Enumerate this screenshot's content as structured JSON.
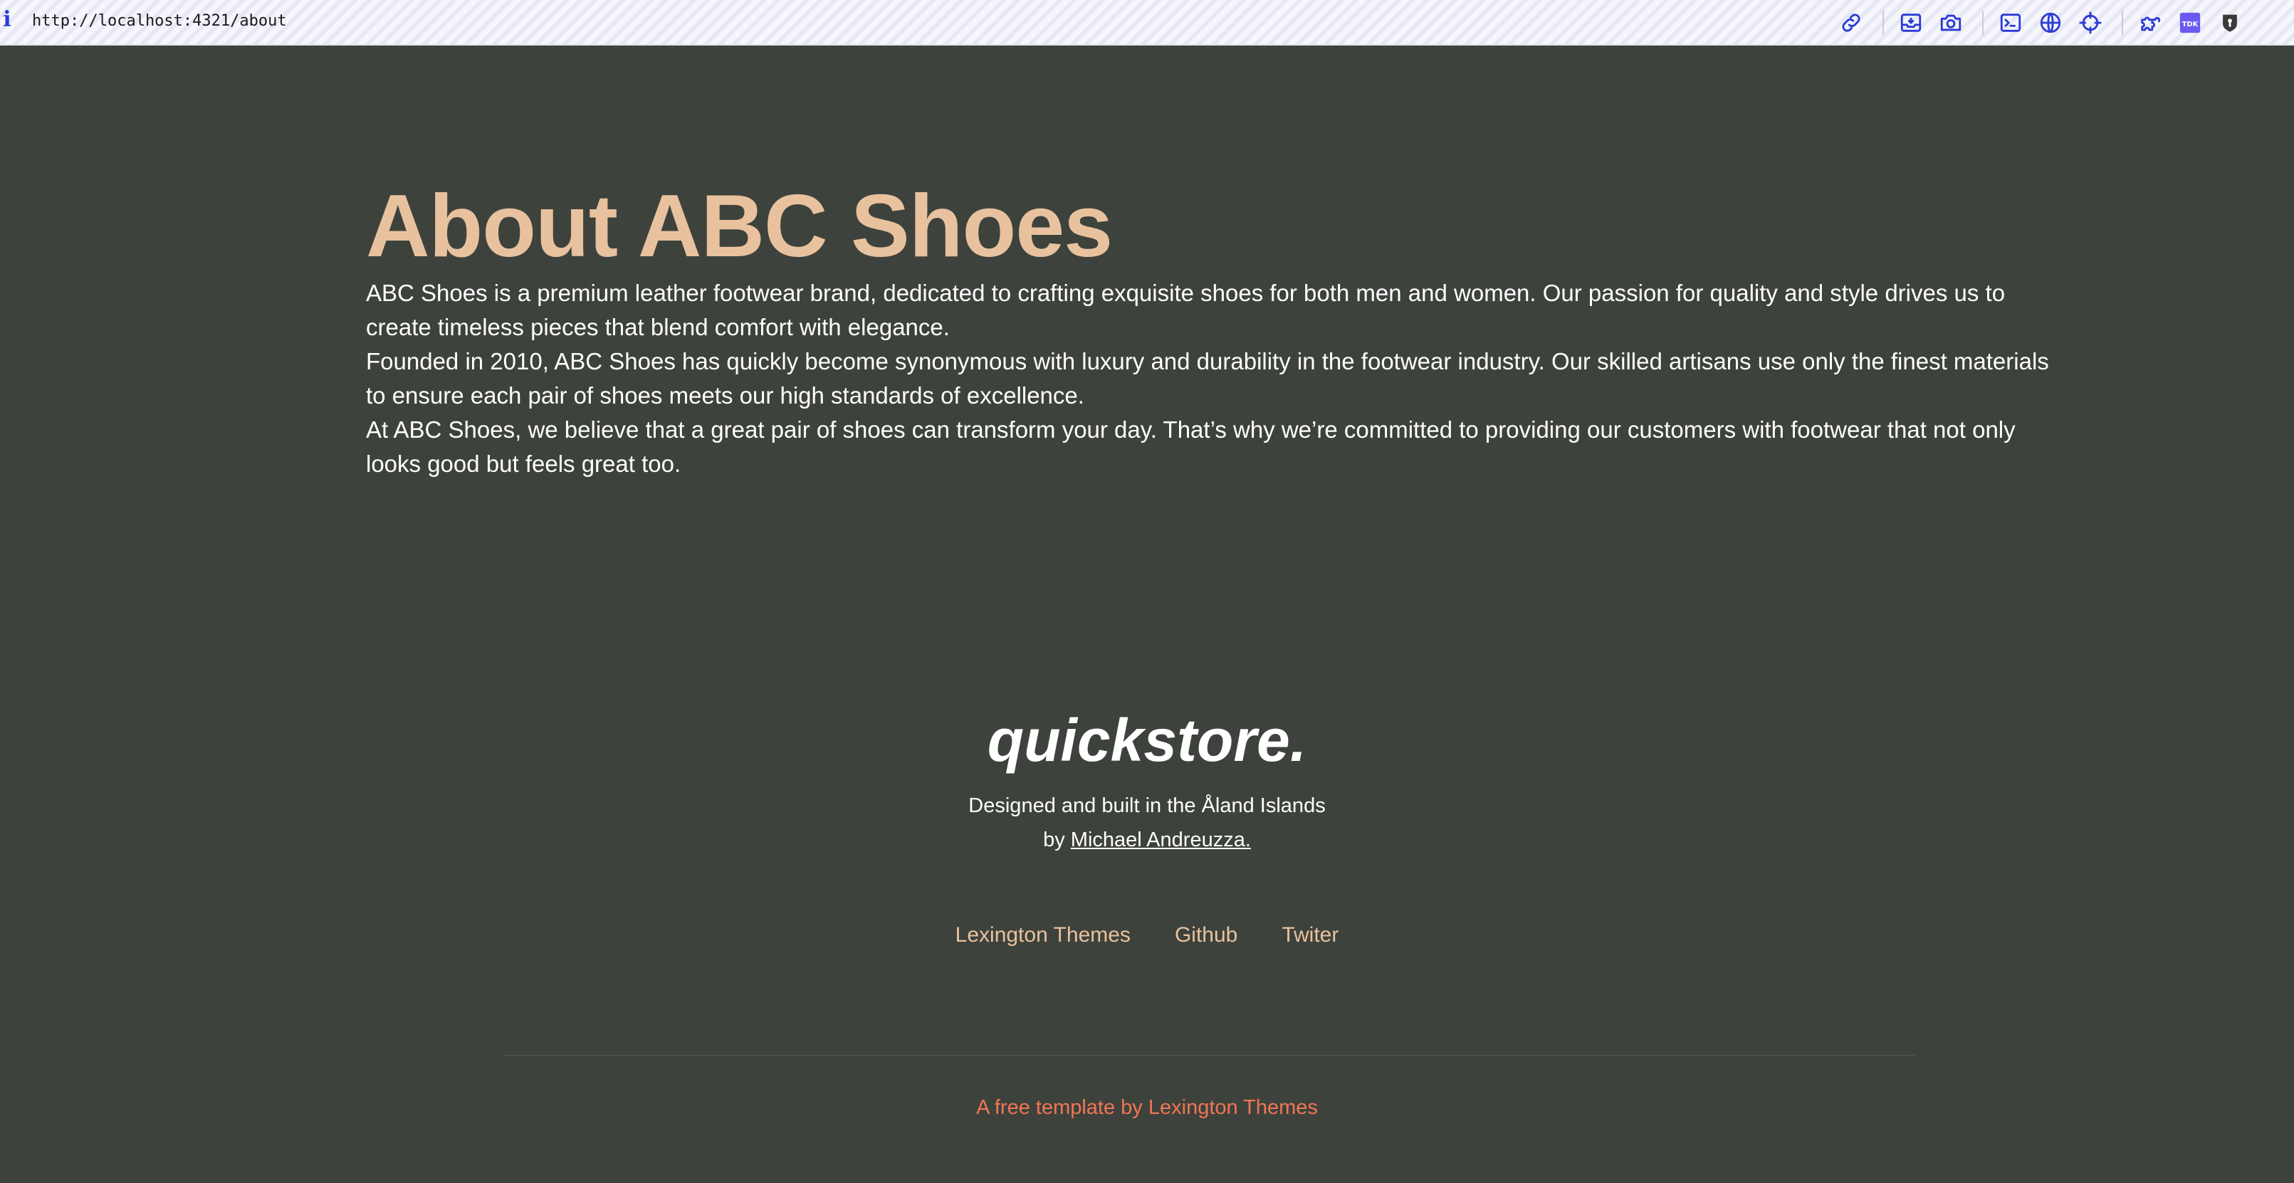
{
  "browser": {
    "url": "http://localhost:4321/about",
    "info_glyph": "i",
    "extensions": [
      "link-icon",
      "download-tray-icon",
      "camera-icon",
      "terminal-icon",
      "globe-icon",
      "crosshair-icon",
      "puzzle-icon",
      "tdk-badge-icon",
      "shield-keyhole-icon"
    ],
    "extension_badge_text": "TDK",
    "accent_color": "#2b3bd6"
  },
  "about": {
    "title": "About ABC Shoes",
    "paragraphs": [
      "ABC Shoes is a premium leather footwear brand, dedicated to crafting exquisite shoes for both men and women. Our passion for quality and style drives us to create timeless pieces that blend comfort with elegance.",
      "Founded in 2010, ABC Shoes has quickly become synonymous with luxury and durability in the footwear industry. Our skilled artisans use only the finest materials to ensure each pair of shoes meets our high standards of excellence.",
      "At ABC Shoes, we believe that a great pair of shoes can transform your day. That’s why we’re committed to providing our customers with footwear that not only looks good but feels great too."
    ]
  },
  "footer": {
    "brand": "quickstore.",
    "tagline_line1": "Designed and built in the Åland Islands",
    "tagline_by": "by ",
    "author_link": "Michael Andreuzza.",
    "links": [
      {
        "label": "Lexington Themes"
      },
      {
        "label": "Github"
      },
      {
        "label": "Twiter"
      }
    ],
    "copyright_prefix": "A free template by ",
    "copyright_link": "Lexington Themes"
  },
  "colors": {
    "background": "#3e423c",
    "accent": "#e8c29e",
    "copyright": "#f07654",
    "text": "#ffffff"
  }
}
